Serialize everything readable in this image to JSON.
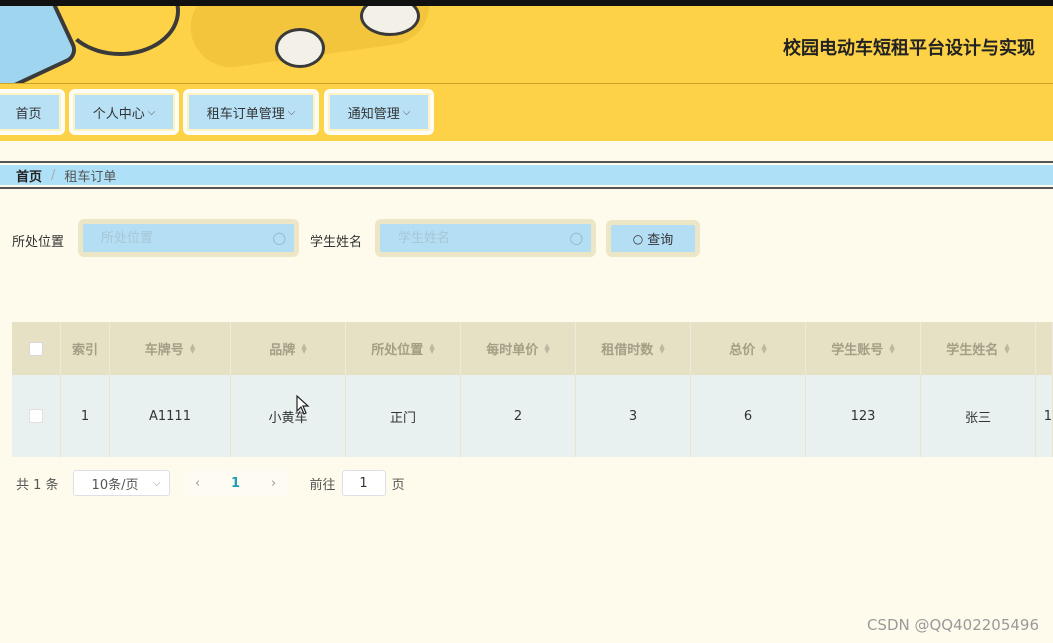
{
  "header": {
    "title": "校园电动车短租平台设计与实现"
  },
  "nav": {
    "items": [
      {
        "label": "首页",
        "has_dropdown": false
      },
      {
        "label": "个人中心",
        "has_dropdown": true
      },
      {
        "label": "租车订单管理",
        "has_dropdown": true
      },
      {
        "label": "通知管理",
        "has_dropdown": true
      }
    ]
  },
  "breadcrumb": {
    "home": "首页",
    "separator": "/",
    "current": "租车订单"
  },
  "search": {
    "location_label": "所处位置",
    "location_placeholder": "所处位置",
    "student_label": "学生姓名",
    "student_placeholder": "学生姓名",
    "query_label": "查询"
  },
  "table": {
    "columns": [
      "索引",
      "车牌号",
      "品牌",
      "所处位置",
      "每时单价",
      "租借时数",
      "总价",
      "学生账号",
      "学生姓名"
    ],
    "rows": [
      [
        "1",
        "A1111",
        "小黄车",
        "正门",
        "2",
        "3",
        "6",
        "123",
        "张三"
      ]
    ],
    "overflow_cell": "1"
  },
  "pagination": {
    "total": "共 1 条",
    "page_size": "10条/页",
    "current_page": "1",
    "goto_prefix": "前往",
    "goto_value": "1",
    "goto_suffix": "页"
  },
  "watermark": "CSDN @QQ402205496",
  "colors": {
    "banner": "#fdd247",
    "nav_button": "#b8e1f5",
    "page_bg": "#fefbec",
    "accent": "#1e9fb5"
  }
}
